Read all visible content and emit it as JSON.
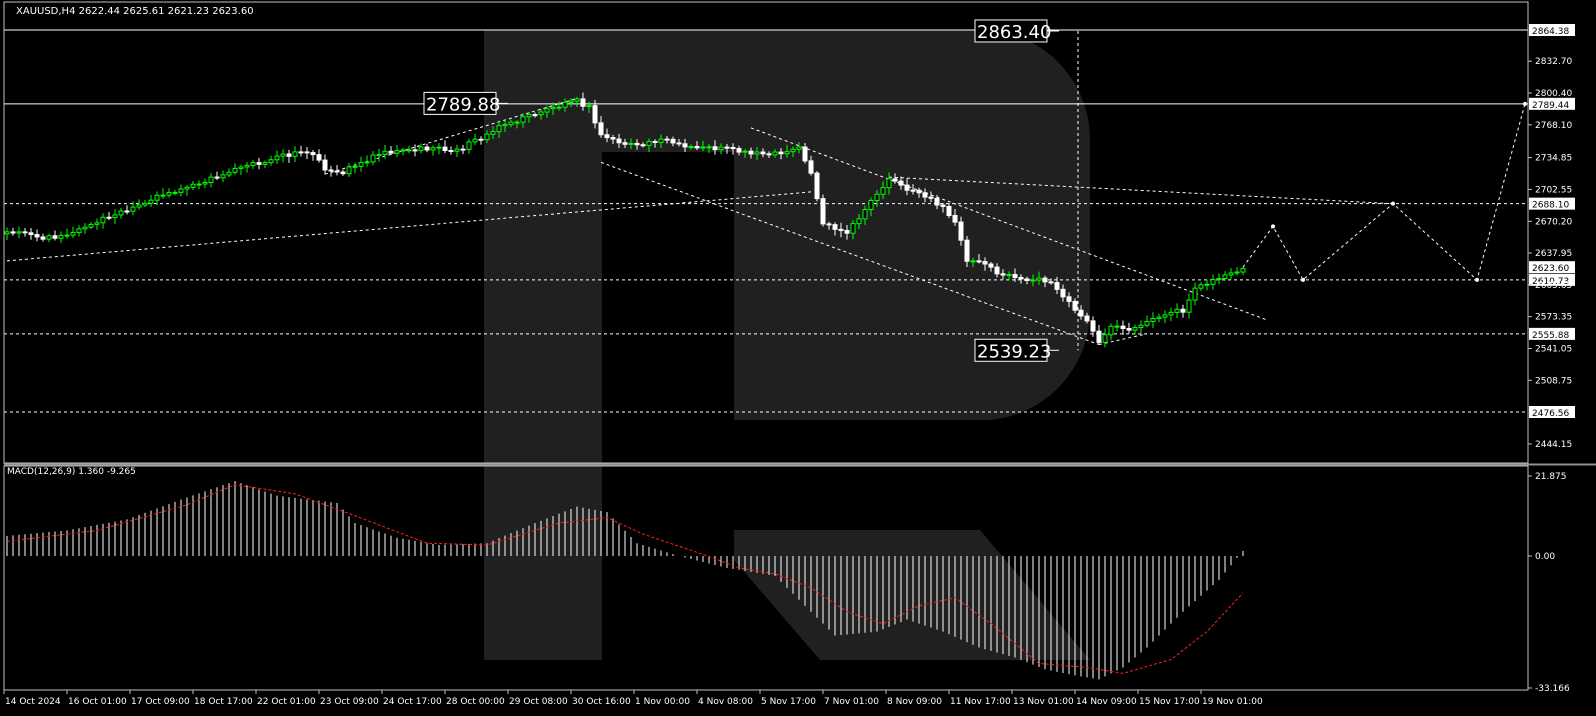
{
  "header": {
    "symbol_line": "XAUUSD,H4  2622.44 2625.61 2621.23 2623.60",
    "macd_label": "MACD(12,26,9) 1.360 -9.265"
  },
  "colors": {
    "background": "#000000",
    "bull": "#00ff00",
    "bear": "#ffffff",
    "signal": "#ff2020",
    "hist": "#ffffff",
    "watermark": "#2b2b2b"
  },
  "chart_data": [
    {
      "type": "candlestick",
      "title": "",
      "symbol": "XAUUSD",
      "timeframe": "H4",
      "ylim": [
        2444.15,
        2880.0
      ],
      "y_ticks": [
        "2832.70",
        "2800.40",
        "2768.10",
        "2734.85",
        "2702.55",
        "2670.20",
        "2637.95",
        "2605.65",
        "2573.35",
        "2541.05",
        "2508.75",
        "2444.15"
      ],
      "x_labels": [
        "14 Oct 2024",
        "16 Oct 01:00",
        "17 Oct 09:00",
        "18 Oct 17:00",
        "22 Oct 01:00",
        "23 Oct 09:00",
        "24 Oct 17:00",
        "28 Oct 00:00",
        "29 Oct 08:00",
        "30 Oct 16:00",
        "1 Nov 00:00",
        "4 Nov 08:00",
        "5 Nov 17:00",
        "7 Nov 01:00",
        "8 Nov 09:00",
        "11 Nov 17:00",
        "13 Nov 01:00",
        "14 Nov 09:00",
        "15 Nov 17:00",
        "19 Nov 01:00"
      ],
      "horizontal_levels": [
        {
          "value": 2864.38,
          "style": "solid",
          "tag": "2864.38"
        },
        {
          "value": 2789.44,
          "style": "solid",
          "tag": "2789.44"
        },
        {
          "value": 2688.1,
          "style": "dashed",
          "tag": "2688.10"
        },
        {
          "value": 2610.73,
          "style": "dashed",
          "tag": "2610.73"
        },
        {
          "value": 2555.88,
          "style": "dashed",
          "tag": "2555.88"
        },
        {
          "value": 2476.56,
          "style": "dashed",
          "tag": "2476.56"
        }
      ],
      "current_price": {
        "value": 2623.6,
        "tag": "2623.60"
      },
      "annotations": [
        {
          "text": "2863.40",
          "value": 2863.4
        },
        {
          "text": "2789.88",
          "value": 2789.88
        },
        {
          "text": "2539.23",
          "value": 2539.23
        }
      ],
      "anchors": [
        {
          "t": 0,
          "c": 2660
        },
        {
          "t": 8,
          "c": 2652
        },
        {
          "t": 15,
          "c": 2670
        },
        {
          "t": 22,
          "c": 2688
        },
        {
          "t": 30,
          "c": 2705
        },
        {
          "t": 38,
          "c": 2722
        },
        {
          "t": 45,
          "c": 2735
        },
        {
          "t": 50,
          "c": 2742
        },
        {
          "t": 53,
          "c": 2724
        },
        {
          "t": 56,
          "c": 2720
        },
        {
          "t": 62,
          "c": 2738
        },
        {
          "t": 70,
          "c": 2745
        },
        {
          "t": 75,
          "c": 2742
        },
        {
          "t": 83,
          "c": 2768
        },
        {
          "t": 88,
          "c": 2780
        },
        {
          "t": 95,
          "c": 2792
        },
        {
          "t": 97,
          "c": 2786
        },
        {
          "t": 99,
          "c": 2758
        },
        {
          "t": 103,
          "c": 2748
        },
        {
          "t": 110,
          "c": 2752
        },
        {
          "t": 115,
          "c": 2745
        },
        {
          "t": 120,
          "c": 2744
        },
        {
          "t": 125,
          "c": 2738
        },
        {
          "t": 130,
          "c": 2742
        },
        {
          "t": 132,
          "c": 2746
        },
        {
          "t": 134,
          "c": 2718
        },
        {
          "t": 136,
          "c": 2668
        },
        {
          "t": 140,
          "c": 2660
        },
        {
          "t": 144,
          "c": 2690
        },
        {
          "t": 147,
          "c": 2712
        },
        {
          "t": 152,
          "c": 2698
        },
        {
          "t": 156,
          "c": 2686
        },
        {
          "t": 158,
          "c": 2668
        },
        {
          "t": 160,
          "c": 2630
        },
        {
          "t": 163,
          "c": 2626
        },
        {
          "t": 166,
          "c": 2616
        },
        {
          "t": 170,
          "c": 2612
        },
        {
          "t": 174,
          "c": 2608
        },
        {
          "t": 177,
          "c": 2588
        },
        {
          "t": 180,
          "c": 2568
        },
        {
          "t": 182,
          "c": 2548
        },
        {
          "t": 184,
          "c": 2566
        },
        {
          "t": 187,
          "c": 2562
        },
        {
          "t": 191,
          "c": 2570
        },
        {
          "t": 194,
          "c": 2580
        },
        {
          "t": 196,
          "c": 2578
        },
        {
          "t": 198,
          "c": 2600
        },
        {
          "t": 200,
          "c": 2608
        },
        {
          "t": 203,
          "c": 2615
        },
        {
          "t": 206,
          "c": 2623.6
        }
      ],
      "macd_histogram_anchors": [
        {
          "t": 0,
          "v": 5.5
        },
        {
          "t": 10,
          "v": 7
        },
        {
          "t": 20,
          "v": 10
        },
        {
          "t": 30,
          "v": 16
        },
        {
          "t": 38,
          "v": 20.5
        },
        {
          "t": 45,
          "v": 16.5
        },
        {
          "t": 55,
          "v": 14.5
        },
        {
          "t": 58,
          "v": 9
        },
        {
          "t": 65,
          "v": 5
        },
        {
          "t": 72,
          "v": 3
        },
        {
          "t": 80,
          "v": 3.5
        },
        {
          "t": 88,
          "v": 9
        },
        {
          "t": 95,
          "v": 13.5
        },
        {
          "t": 100,
          "v": 12
        },
        {
          "t": 105,
          "v": 3.5
        },
        {
          "t": 112,
          "v": 0
        },
        {
          "t": 120,
          "v": -3
        },
        {
          "t": 128,
          "v": -5
        },
        {
          "t": 134,
          "v": -14
        },
        {
          "t": 138,
          "v": -20
        },
        {
          "t": 145,
          "v": -19
        },
        {
          "t": 150,
          "v": -16
        },
        {
          "t": 156,
          "v": -19
        },
        {
          "t": 162,
          "v": -23
        },
        {
          "t": 168,
          "v": -25.5
        },
        {
          "t": 173,
          "v": -28.5
        },
        {
          "t": 178,
          "v": -30
        },
        {
          "t": 182,
          "v": -31
        },
        {
          "t": 186,
          "v": -28
        },
        {
          "t": 190,
          "v": -23
        },
        {
          "t": 196,
          "v": -14
        },
        {
          "t": 202,
          "v": -6
        },
        {
          "t": 206,
          "v": 1.36
        }
      ],
      "macd_signal_anchors": [
        {
          "t": 0,
          "v": 4
        },
        {
          "t": 15,
          "v": 7
        },
        {
          "t": 30,
          "v": 14
        },
        {
          "t": 38,
          "v": 19.5
        },
        {
          "t": 48,
          "v": 17
        },
        {
          "t": 58,
          "v": 11
        },
        {
          "t": 70,
          "v": 3.5
        },
        {
          "t": 80,
          "v": 3
        },
        {
          "t": 92,
          "v": 9
        },
        {
          "t": 100,
          "v": 10.5
        },
        {
          "t": 106,
          "v": 6
        },
        {
          "t": 115,
          "v": 1
        },
        {
          "t": 122,
          "v": -3
        },
        {
          "t": 128,
          "v": -4.5
        },
        {
          "t": 134,
          "v": -8
        },
        {
          "t": 140,
          "v": -14
        },
        {
          "t": 146,
          "v": -17
        },
        {
          "t": 152,
          "v": -12.5
        },
        {
          "t": 158,
          "v": -10.5
        },
        {
          "t": 164,
          "v": -17
        },
        {
          "t": 172,
          "v": -27
        },
        {
          "t": 180,
          "v": -28
        },
        {
          "t": 186,
          "v": -29.5
        },
        {
          "t": 194,
          "v": -26
        },
        {
          "t": 200,
          "v": -19
        },
        {
          "t": 206,
          "v": -9.265
        }
      ],
      "macd_ylim": [
        -33.166,
        21.875
      ],
      "macd_ticks": [
        "21.875",
        "0.00",
        "-33.166"
      ],
      "forecast_path": [
        {
          "t": 206,
          "v": 2623.6
        },
        {
          "t": 211,
          "v": 2665
        },
        {
          "t": 216,
          "v": 2610.73
        },
        {
          "t": 231,
          "v": 2688.1
        },
        {
          "t": 245,
          "v": 2610.73
        },
        {
          "t": 253,
          "v": 2789.44
        }
      ],
      "trendlines": [
        {
          "p1": {
            "t": 0,
            "v": 2630
          },
          "p2": {
            "t": 134,
            "v": 2700
          }
        },
        {
          "p1": {
            "t": 53,
            "v": 2718
          },
          "p2": {
            "t": 95,
            "v": 2795
          }
        },
        {
          "p1": {
            "t": 99,
            "v": 2730
          },
          "p2": {
            "t": 182,
            "v": 2545
          }
        },
        {
          "p1": {
            "t": 124,
            "v": 2765
          },
          "p2": {
            "t": 210,
            "v": 2570
          }
        },
        {
          "p1": {
            "t": 147,
            "v": 2715
          },
          "p2": {
            "t": 231,
            "v": 2688
          }
        },
        {
          "p1": {
            "t": 182,
            "v": 2545
          },
          "p2": {
            "t": 190,
            "v": 2556
          }
        }
      ]
    }
  ]
}
